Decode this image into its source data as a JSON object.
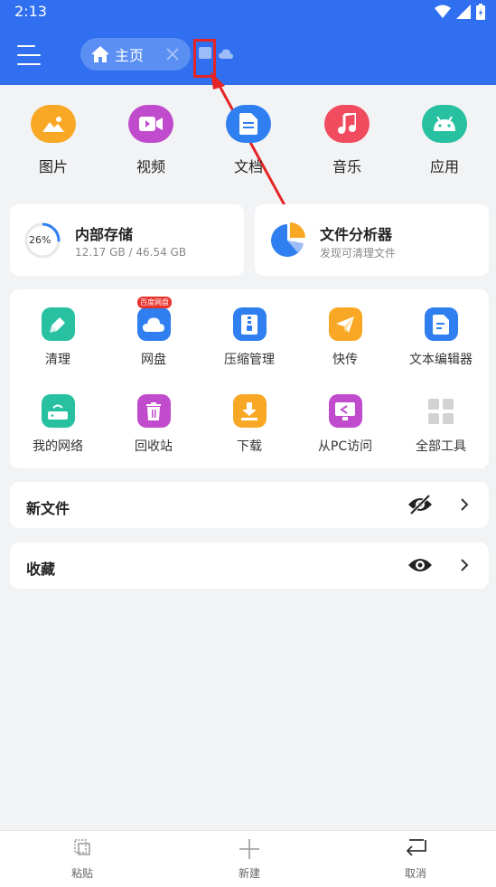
{
  "status_bar": {
    "time": "2:13"
  },
  "app_bar": {
    "home_tab_label": "主页"
  },
  "categories": [
    {
      "label": "图片",
      "icon": "image-icon",
      "color": "#f9a825"
    },
    {
      "label": "视频",
      "icon": "video-icon",
      "color": "#c04ccd"
    },
    {
      "label": "文档",
      "icon": "document-icon",
      "color": "#2f7ff0"
    },
    {
      "label": "音乐",
      "icon": "music-icon",
      "color": "#f04b5e"
    },
    {
      "label": "应用",
      "icon": "android-icon",
      "color": "#27c0a0"
    }
  ],
  "storage": {
    "percent_label": "26%",
    "percent": 0.26,
    "title": "内部存储",
    "detail": "12.17 GB / 46.54 GB"
  },
  "analyzer": {
    "title": "文件分析器",
    "subtitle": "发现可清理文件"
  },
  "tools": [
    {
      "label": "清理",
      "icon": "broom-icon",
      "color": "#27c0a0"
    },
    {
      "label": "网盘",
      "icon": "cloud-disk-icon",
      "color": "#2f7ff0",
      "badge": "百度网盘"
    },
    {
      "label": "压缩管理",
      "icon": "zip-icon",
      "color": "#2f7ff0"
    },
    {
      "label": "快传",
      "icon": "paper-plane-icon",
      "color": "#f9a825"
    },
    {
      "label": "文本编辑器",
      "icon": "text-editor-icon",
      "color": "#2f7ff0"
    },
    {
      "label": "我的网络",
      "icon": "router-icon",
      "color": "#27c0a0"
    },
    {
      "label": "回收站",
      "icon": "trash-icon",
      "color": "#c04ccd"
    },
    {
      "label": "下载",
      "icon": "download-icon",
      "color": "#f9a825"
    },
    {
      "label": "从PC访问",
      "icon": "pc-access-icon",
      "color": "#c04ccd"
    },
    {
      "label": "全部工具",
      "icon": "grid-icon",
      "color": "#cfcfcf"
    }
  ],
  "sections": [
    {
      "title": "新文件",
      "eye": "eye-off-icon"
    },
    {
      "title": "收藏",
      "eye": "eye-icon"
    }
  ],
  "bottom_bar": {
    "paste": "粘贴",
    "new": "新建",
    "cancel": "取消"
  },
  "colors": {
    "primary": "#2f6ff0",
    "annotation": "#e52525"
  }
}
